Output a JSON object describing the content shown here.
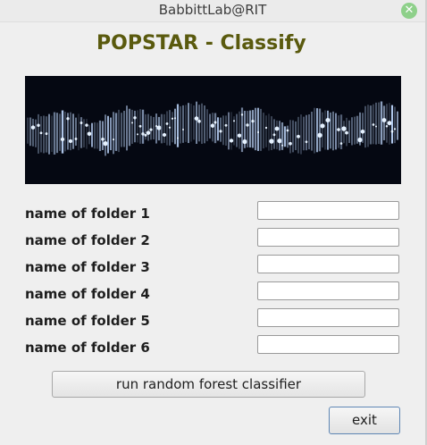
{
  "window": {
    "title": "BabbittLab@RIT",
    "close_icon": "close-icon"
  },
  "app": {
    "title": "POPSTAR - Classify",
    "title_color": "#5a5a0e"
  },
  "banner": {
    "image": "spectrogram-banner"
  },
  "fields": [
    {
      "label": "name of folder 1",
      "value": ""
    },
    {
      "label": "name of folder 2",
      "value": ""
    },
    {
      "label": "name of folder 3",
      "value": ""
    },
    {
      "label": "name of folder 4",
      "value": ""
    },
    {
      "label": "name of folder 5",
      "value": ""
    },
    {
      "label": "name of folder 6",
      "value": ""
    }
  ],
  "actions": {
    "run_label": "run random forest classifier",
    "exit_label": "exit"
  }
}
